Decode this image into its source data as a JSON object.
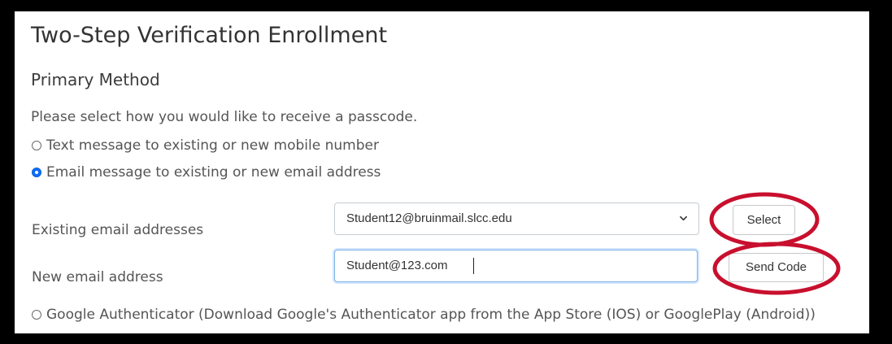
{
  "page": {
    "title": "Two-Step Verification Enrollment",
    "subtitle": "Primary Method",
    "instruction": "Please select how you would like to receive a passcode."
  },
  "options": {
    "text_message": {
      "label": "Text message to existing or new mobile number",
      "selected": false
    },
    "email_message": {
      "label": "Email message to existing or new email address",
      "selected": true
    },
    "google_authenticator": {
      "label": "Google Authenticator (Download Google's Authenticator app from the App Store (IOS) or GooglePlay (Android))",
      "selected": false
    }
  },
  "existing_email": {
    "label": "Existing email addresses",
    "selected_value": "Student12@bruinmail.slcc.edu",
    "button_label": "Select"
  },
  "new_email": {
    "label": "New email address",
    "value": "Student@123.com",
    "button_label": "Send Code"
  },
  "colors": {
    "frame_border": "#000000",
    "annotation_circle": "#c8102e",
    "radio_selected": "#0d6efd"
  }
}
